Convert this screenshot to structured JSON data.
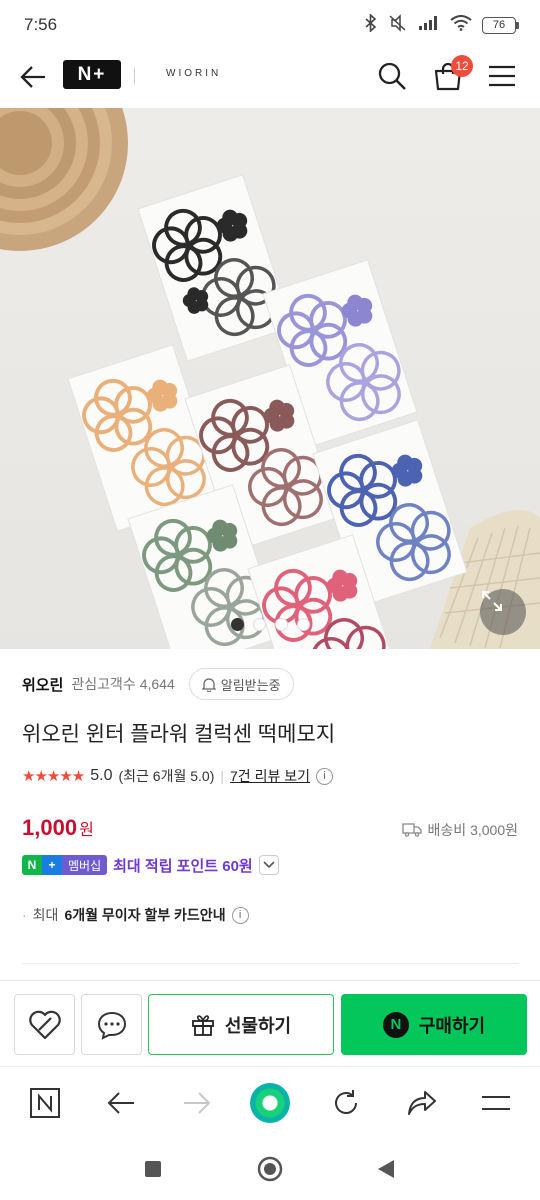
{
  "status_bar": {
    "time": "7:56",
    "battery": "76"
  },
  "header": {
    "logo": "N+",
    "brand": "WIORIN",
    "cart_count": "12"
  },
  "hero": {
    "image_count": 4,
    "active_index": 0
  },
  "product": {
    "seller": "위오린",
    "watchers": "관심고객수 4,644",
    "alarm_label": "알림받는중",
    "title": "위오린 윈터 플라워 컬럭센 떡메모지",
    "stars": "★★★★★",
    "score": "5.0",
    "recent": "(최근 6개월 5.0)",
    "sep": "|",
    "review_link": "7건 리뷰 보기",
    "price": "1,000",
    "price_unit": "원",
    "shipping": "배송비 3,000원",
    "membership": {
      "n": "N",
      "plus": "+",
      "label": "멤버십"
    },
    "points": "최대 적립 포인트 60원",
    "install_prefix": "최대",
    "install_bold": "6개월 무이자 할부 카드안내",
    "info_mark": "i"
  },
  "actions": {
    "gift_label": "선물하기",
    "buy_label": "구매하기",
    "npay_mark": "N"
  },
  "colors": {
    "accent_green": "#03c75a",
    "price_red": "#c8102e",
    "points_purple": "#6d3bd2",
    "star_red": "#f04c3c"
  }
}
